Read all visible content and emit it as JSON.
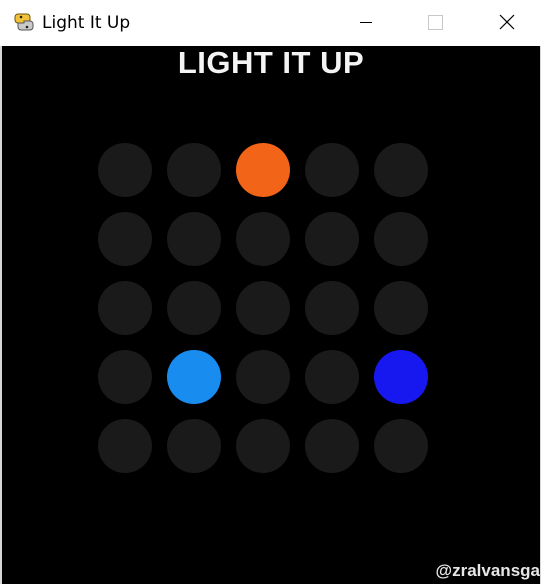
{
  "window": {
    "title": "Light It Up",
    "app_icon": "python-snake-icon",
    "controls": [
      "minimize-icon",
      "maximize-icon",
      "close-icon"
    ]
  },
  "game": {
    "title": "LIGHT IT UP",
    "credit": "@zralvansga",
    "background_color": "#000000",
    "off_color": "#1a1a1a",
    "grid": {
      "rows": 5,
      "cols": 5,
      "lit": [
        {
          "row": 0,
          "col": 2,
          "color": "#f26418"
        },
        {
          "row": 3,
          "col": 1,
          "color": "#198cf0"
        },
        {
          "row": 3,
          "col": 4,
          "color": "#1717f0"
        }
      ]
    }
  }
}
